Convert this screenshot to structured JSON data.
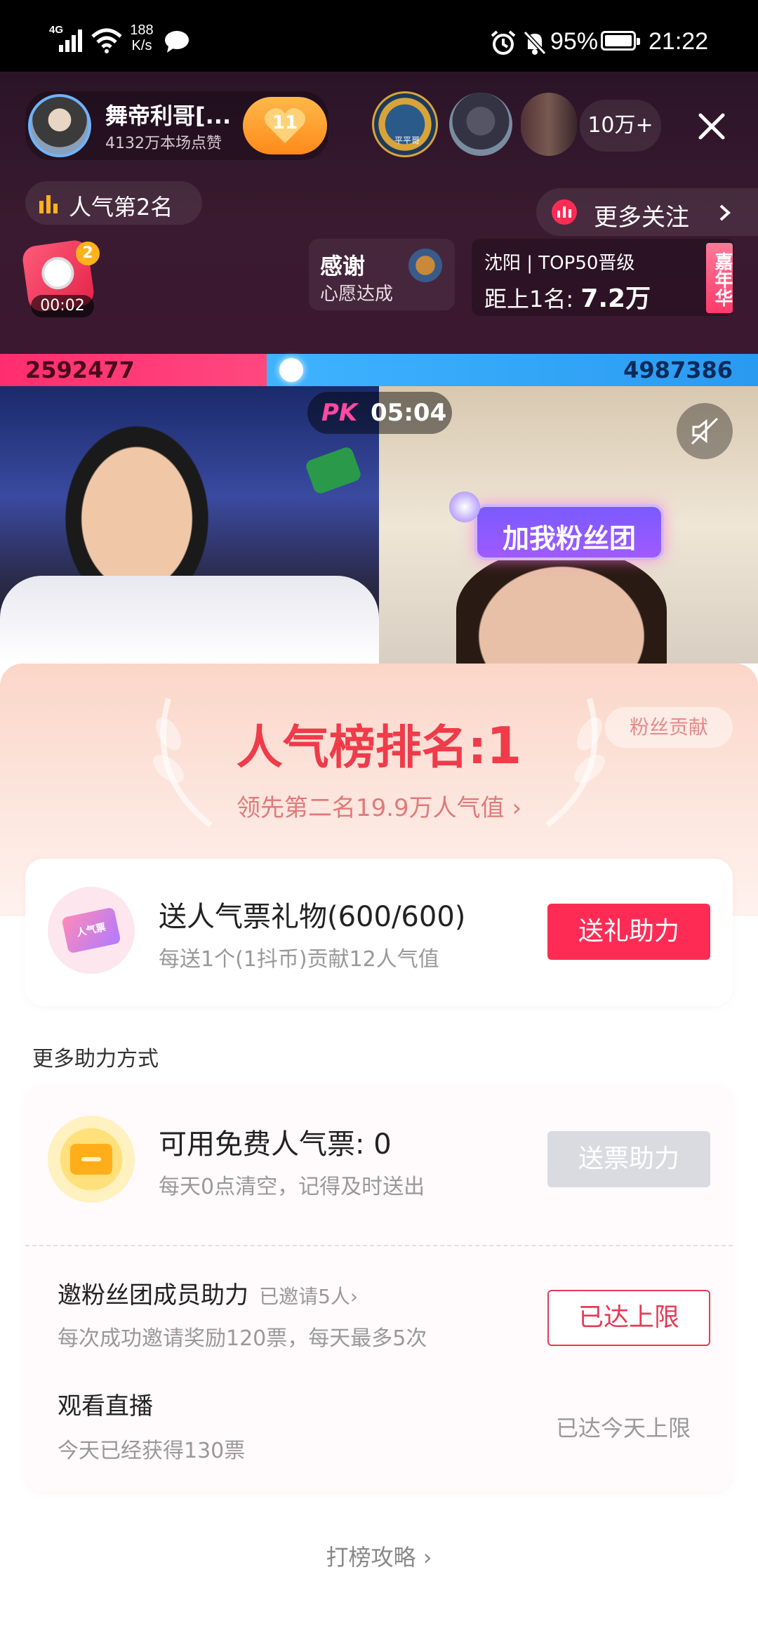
{
  "status_bar": {
    "network": "4G",
    "speed_value": "188",
    "speed_unit": "K/s",
    "battery": "95%",
    "time": "21:22"
  },
  "live": {
    "host_name": "舞帝利哥[...",
    "host_likes": "4132万本场点赞",
    "fan_level": "11",
    "viewer_count": "10万+",
    "popularity_rank": "人气第2名",
    "more_follow": "更多关注",
    "gift_count": "2",
    "gift_timer": "00:02",
    "thanks_title": "感谢",
    "thanks_sub": "心愿达成",
    "region_line": "沈阳 | TOP50晋级",
    "distance_label": "距上1名:",
    "distance_value": "7.2万",
    "carnival": "嘉年华",
    "badge_text": "平平哥"
  },
  "pk": {
    "left_score": "2592477",
    "right_score": "4987386",
    "timer": "05:04",
    "pk_label": "PK",
    "fan_group_badge": "加我粉丝团"
  },
  "sheet": {
    "rank_label": "人气榜排名:",
    "rank_value": "1",
    "lead_text": "领先第二名19.9万人气值",
    "fan_contrib": "粉丝贡献",
    "gift_card": {
      "title": "送人气票礼物(600/600)",
      "subtitle": "每送1个(1抖币)贡献12人气值",
      "button": "送礼助力",
      "ticket_text": "人气票"
    },
    "more_ways": "更多助力方式",
    "free_ticket": {
      "title": "可用免费人气票: 0",
      "subtitle": "每天0点清空，记得及时送出",
      "button": "送票助力"
    },
    "invite": {
      "title": "邀粉丝团成员助力",
      "invited": "已邀请5人",
      "subtitle": "每次成功邀请奖励120票，每天最多5次",
      "button": "已达上限"
    },
    "watch": {
      "title": "观看直播",
      "subtitle": "今天已经获得130票",
      "status": "已达今天上限"
    },
    "strategy_link": "打榜攻略"
  },
  "colors": {
    "accent_red": "#fe2c55",
    "header_bg": "#2b1428",
    "pk_left": "#ff2d6f",
    "pk_right": "#2aa3ff"
  }
}
